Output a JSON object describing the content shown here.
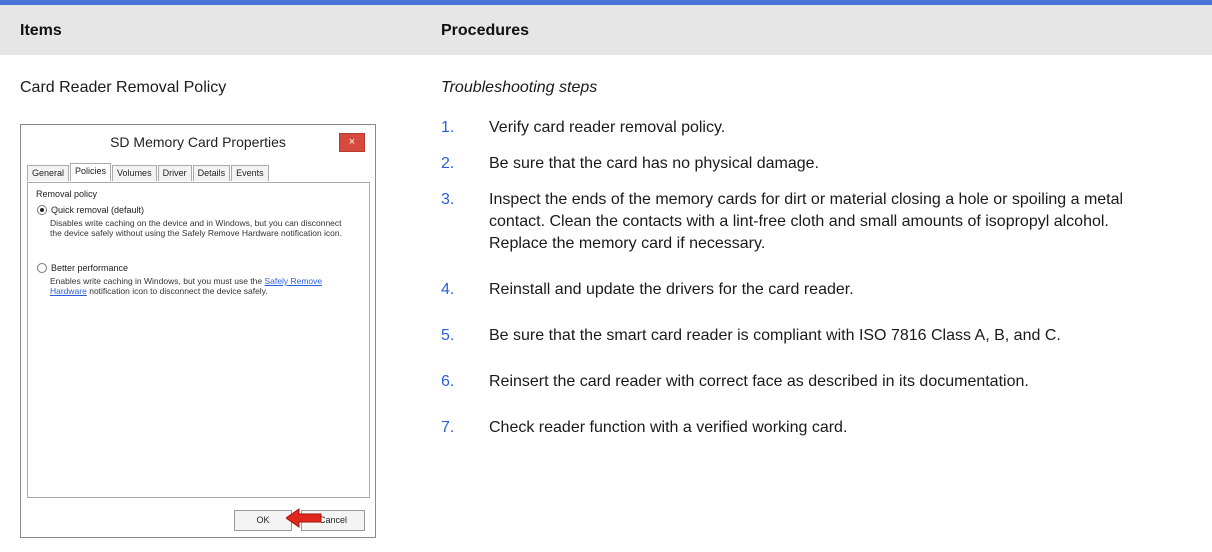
{
  "header": {
    "col_items": "Items",
    "col_procedures": "Procedures"
  },
  "item_title": "Card Reader Removal Policy",
  "sub_heading": "Troubleshooting steps",
  "steps": [
    {
      "num": "1.",
      "text": "Verify card reader removal policy."
    },
    {
      "num": "2.",
      "text": "Be sure that the card has no physical damage."
    },
    {
      "num": "3.",
      "text": "Inspect the ends of the memory cards for dirt or material closing a hole or spoiling a metal contact. Clean the contacts with a lint-free cloth and small amounts of isopropyl alcohol. Replace the memory card if necessary."
    },
    {
      "num": "4.",
      "text": "Reinstall and update the drivers for the card reader."
    },
    {
      "num": "5.",
      "text": "Be sure that the smart card reader is compliant with ISO 7816 Class A, B, and C."
    },
    {
      "num": "6.",
      "text": "Reinsert the card reader with correct face as described in its documentation."
    },
    {
      "num": "7.",
      "text": "Check reader function with a verified working card."
    }
  ],
  "dialog": {
    "title": "SD Memory Card Properties",
    "close": "×",
    "tabs": [
      "General",
      "Policies",
      "Volumes",
      "Driver",
      "Details",
      "Events"
    ],
    "active_tab": "Policies",
    "group_label": "Removal policy",
    "options": [
      {
        "label": "Quick removal (default)",
        "checked": true,
        "desc": "Disables write caching on the device and in Windows, but you can disconnect the device safely without using the Safely Remove Hardware notification icon."
      },
      {
        "label": "Better performance",
        "checked": false,
        "desc_before": "Enables write caching in Windows, but you must use the ",
        "desc_link": "Safely Remove Hardware",
        "desc_after": " notification icon to disconnect the device safely."
      }
    ],
    "ok": "OK",
    "cancel": "Cancel"
  },
  "colors": {
    "accent_bar": "#4a74d8",
    "header_bg": "#e6e6e6",
    "step_number": "#2a5fd8",
    "arrow": "#e0281c"
  }
}
